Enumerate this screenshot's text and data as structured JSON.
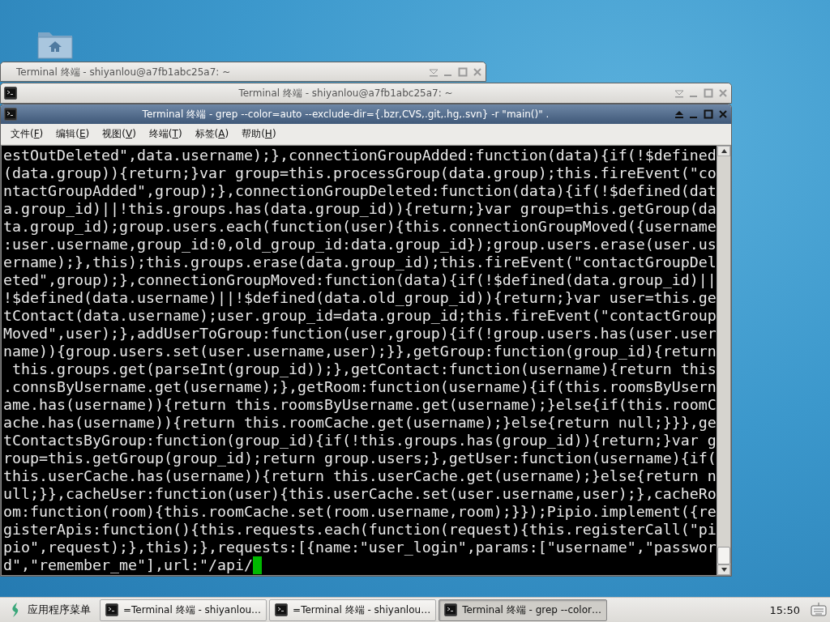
{
  "windows": [
    {
      "title": "Terminal 终端 - shiyanlou@a7fb1abc25a7: ~",
      "active": false,
      "icon": false
    },
    {
      "title": "Terminal 终端 - shiyanlou@a7fb1abc25a7: ~",
      "active": false,
      "icon": true
    },
    {
      "title": "Terminal 终端 - grep --color=auto --exclude-dir={.bzr,CVS,.git,.hg,.svn} -r \"main()\" .",
      "active": true,
      "icon": true,
      "menu": [
        "文件(F)",
        "编辑(E)",
        "视图(V)",
        "终端(T)",
        "标签(A)",
        "帮助(H)"
      ],
      "terminal": {
        "cursor": true,
        "lines": [
          "estOutDeleted\",data.username);},connectionGroupAdded:function(data){if(!$defined",
          "(data.group)){return;}var group=this.processGroup(data.group);this.fireEvent(\"co",
          "ntactGroupAdded\",group);},connectionGroupDeleted:function(data){if(!$defined(dat",
          "a.group_id)||!this.groups.has(data.group_id)){return;}var group=this.getGroup(da",
          "ta.group_id);group.users.each(function(user){this.connectionGroupMoved({username",
          ":user.username,group_id:0,old_group_id:data.group_id});group.users.erase(user.us",
          "ername);},this);this.groups.erase(data.group_id);this.fireEvent(\"contactGroupDel",
          "eted\",group);},connectionGroupMoved:function(data){if(!$defined(data.group_id)||",
          "!$defined(data.username)||!$defined(data.old_group_id)){return;}var user=this.ge",
          "tContact(data.username);user.group_id=data.group_id;this.fireEvent(\"contactGroup",
          "Moved\",user);},addUserToGroup:function(user,group){if(!group.users.has(user.user",
          "name)){group.users.set(user.username,user);}},getGroup:function(group_id){return",
          " this.groups.get(parseInt(group_id));},getContact:function(username){return this",
          ".connsByUsername.get(username);},getRoom:function(username){if(this.roomsByUsern",
          "ame.has(username)){return this.roomsByUsername.get(username);}else{if(this.roomC",
          "ache.has(username)){return this.roomCache.get(username);}else{return null;}}},ge",
          "tContactsByGroup:function(group_id){if(!this.groups.has(group_id)){return;}var g",
          "roup=this.getGroup(group_id);return group.users;},getUser:function(username){if(",
          "this.userCache.has(username)){return this.userCache.get(username);}else{return n",
          "ull;}},cacheUser:function(user){this.userCache.set(user.username,user);},cacheRo",
          "om:function(room){this.roomCache.set(room.username,room);}});Pipio.implement({re",
          "gisterApis:function(){this.requests.each(function(request){this.registerCall(\"pi",
          "pio\",request);},this);},requests:[{name:\"user_login\",params:[\"username\",\"passwor",
          "d\",\"remember_me\"],url:\"/api/"
        ]
      }
    }
  ],
  "taskbar": {
    "start_menu": "应用程序菜单",
    "tasks": [
      {
        "label": "=Terminal 终端 - shiyanlou…",
        "selected": false
      },
      {
        "label": "=Terminal 终端 - shiyanlou…",
        "selected": false
      },
      {
        "label": "Terminal 终端 - grep --color…",
        "selected": true
      }
    ],
    "clock": "15:50"
  }
}
